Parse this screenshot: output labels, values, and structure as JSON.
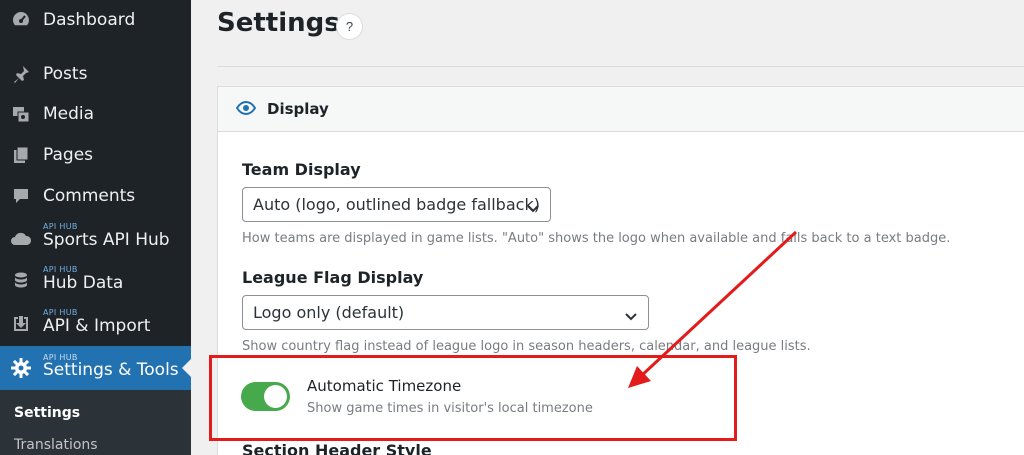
{
  "sidebar": {
    "items": [
      {
        "label": "Dashboard",
        "tag": "",
        "icon": "dashboard-icon"
      },
      {
        "label": "Posts",
        "tag": "",
        "icon": "pin-icon"
      },
      {
        "label": "Media",
        "tag": "",
        "icon": "media-icon"
      },
      {
        "label": "Pages",
        "tag": "",
        "icon": "pages-icon"
      },
      {
        "label": "Comments",
        "tag": "",
        "icon": "comments-icon"
      },
      {
        "label": "Sports API Hub",
        "tag": "API HUB",
        "icon": "cloud-icon"
      },
      {
        "label": "Hub Data",
        "tag": "API HUB",
        "icon": "database-icon"
      },
      {
        "label": "API & Import",
        "tag": "API HUB",
        "icon": "import-icon"
      },
      {
        "label": "Settings & Tools",
        "tag": "API HUB",
        "icon": "gear-icon",
        "active": true
      }
    ],
    "submenu": [
      {
        "label": "Settings",
        "current": true
      },
      {
        "label": "Translations",
        "current": false
      }
    ],
    "colors": {
      "background": "#1d2327",
      "active": "#2271b1",
      "submenu": "#2c3338"
    }
  },
  "main": {
    "title": "Settings",
    "help_label": "?"
  },
  "panel": {
    "title": "Display",
    "icon": "eye-icon",
    "team_display": {
      "label": "Team Display",
      "value": "Auto (logo, outlined badge fallback)",
      "description": "How teams are displayed in game lists. \"Auto\" shows the logo when available and falls back to a text badge."
    },
    "league_flag": {
      "label": "League Flag Display",
      "value": "Logo only (default)",
      "description": "Show country flag instead of league logo in season headers, calendar, and league lists."
    },
    "auto_timezone": {
      "label": "Automatic Timezone",
      "description": "Show game times in visitor's local timezone",
      "enabled": true,
      "toggle_color": "#46a94b"
    },
    "next_section_label": "Section Header Style"
  },
  "annotation": {
    "color": "#e31b1b"
  }
}
